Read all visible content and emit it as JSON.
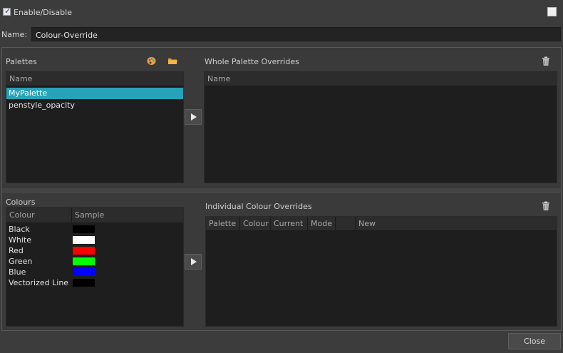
{
  "header": {
    "enable_label": "Enable/Disable",
    "enabled": true,
    "name_label": "Name:",
    "name_value": "Colour-Override"
  },
  "palettes": {
    "label": "Palettes",
    "columns": [
      "Name"
    ],
    "items": [
      "MyPalette",
      "penstyle_opacity"
    ],
    "selected_index": 0,
    "icons": [
      "palette-icon",
      "folder-icon"
    ]
  },
  "whole_palette_overrides": {
    "label": "Whole Palette Overrides",
    "columns": [
      "Name"
    ]
  },
  "colours": {
    "label": "Colours",
    "columns": [
      "Colour",
      "Sample"
    ],
    "items": [
      {
        "name": "Black",
        "color": "#000000"
      },
      {
        "name": "White",
        "color": "#ffffff"
      },
      {
        "name": "Red",
        "color": "#ff0000"
      },
      {
        "name": "Green",
        "color": "#00ff00"
      },
      {
        "name": "Blue",
        "color": "#0000ff"
      },
      {
        "name": "Vectorized Line",
        "color": "#000000"
      }
    ]
  },
  "individual_colour_overrides": {
    "label": "Individual Colour Overrides",
    "columns": [
      "Palette",
      "Colour",
      "Current",
      "Mode",
      "",
      "New"
    ]
  },
  "footer": {
    "close_label": "Close"
  },
  "colors": {
    "selection": "#27a3b8",
    "background": "#3c3c3c",
    "panel": "#1e1e1e"
  }
}
